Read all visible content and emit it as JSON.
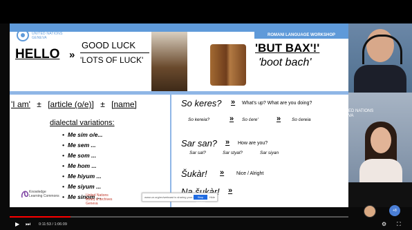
{
  "slide": {
    "un_text": "UNITED NATIONS\nGENEVA",
    "hello": "HELLO",
    "arrow": "»",
    "good_luck": "GOOD LUCK",
    "lots_of_luck": "'LOTS OF LUCK'",
    "workshop": "ROMANI LANGUAGE WORKSHOP",
    "but_bax": "'BUT BAX'!'",
    "boot_bach": "'boot bach'",
    "formula": {
      "i_am": "'I am'",
      "plus1": "±",
      "article": "[article (o/e)]",
      "plus2": "±",
      "name": "[name]"
    },
    "dialectal_title": "dialectal variations:",
    "dialectal_items": [
      "Me sím o/e...",
      "Me sem ...",
      "Me som ...",
      "Me hom ...",
      "Me hiyum ...",
      "Me siyum ...",
      "Me sinom ..."
    ],
    "phrases": {
      "so_keres": "So keres?",
      "so_keres_tr": "What's up? What are you doing?",
      "so_kereia": "So kereia?",
      "so_cere": "So ćere'",
      "so_cereia": "So ćereia",
      "sar_san": "Sar san?",
      "sar_san_tr": "How are you?",
      "sar_sal": "Sar sal?",
      "sar_styal": "Sar styal?",
      "sar_siyan": "Sar siyan",
      "sukar": "Šukàr!",
      "sukar_tr": "Nice / Alright",
      "na_sukar": "Na šukàr!"
    },
    "logos": {
      "knowledge": "Knowledge\nLearning Commons",
      "library": "United Nations\nlibrary & archives\nGeneva"
    },
    "popup": {
      "text": "www.un.org/en/webcast is sharing your screen",
      "stop": "Stop sharing",
      "hide": "Hide"
    }
  },
  "participants": {
    "wall_text": "ED NATIONS\nVA",
    "strip_label": "Shay Hong",
    "avatar_initials": "+8"
  },
  "player": {
    "time": "0:11:53 / 1:06:09",
    "progress": 0.18
  }
}
